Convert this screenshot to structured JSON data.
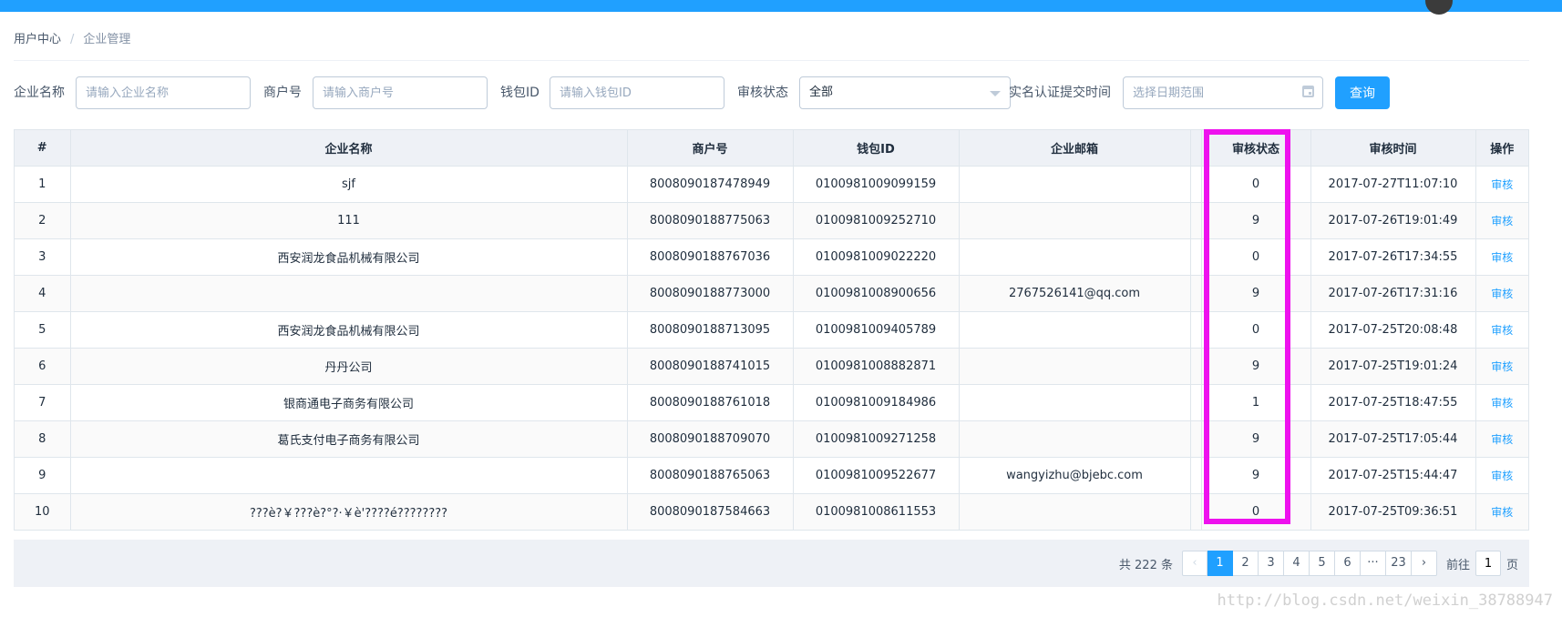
{
  "breadcrumb": {
    "root": "用户中心",
    "separator": "/",
    "current": "企业管理"
  },
  "filters": {
    "company_name_label": "企业名称",
    "company_name_placeholder": "请输入企业名称",
    "merchant_label": "商户号",
    "merchant_placeholder": "请输入商户号",
    "wallet_label": "钱包ID",
    "wallet_placeholder": "请输入钱包ID",
    "status_label": "审核状态",
    "status_value": "全部",
    "date_label": "实名认证提交时间",
    "date_placeholder": "选择日期范围",
    "query_button": "查询"
  },
  "table": {
    "headers": [
      "#",
      "企业名称",
      "商户号",
      "钱包ID",
      "企业邮箱",
      "",
      "审核状态",
      "审核时间",
      "操作"
    ],
    "rows": [
      {
        "idx": "1",
        "name": "sjf",
        "merchant": "8008090187478949",
        "wallet": "0100981009099159",
        "email": "",
        "status": "0",
        "time": "2017-07-27T11:07:10",
        "action": "审核"
      },
      {
        "idx": "2",
        "name": "111",
        "merchant": "8008090188775063",
        "wallet": "0100981009252710",
        "email": "",
        "status": "9",
        "time": "2017-07-26T19:01:49",
        "action": "审核"
      },
      {
        "idx": "3",
        "name": "西安润龙食品机械有限公司",
        "merchant": "8008090188767036",
        "wallet": "0100981009022220",
        "email": "",
        "status": "0",
        "time": "2017-07-26T17:34:55",
        "action": "审核"
      },
      {
        "idx": "4",
        "name": "",
        "merchant": "8008090188773000",
        "wallet": "0100981008900656",
        "email": "2767526141@qq.com",
        "status": "9",
        "time": "2017-07-26T17:31:16",
        "action": "审核"
      },
      {
        "idx": "5",
        "name": "西安润龙食品机械有限公司",
        "merchant": "8008090188713095",
        "wallet": "0100981009405789",
        "email": "",
        "status": "0",
        "time": "2017-07-25T20:08:48",
        "action": "审核"
      },
      {
        "idx": "6",
        "name": "丹丹公司",
        "merchant": "8008090188741015",
        "wallet": "0100981008882871",
        "email": "",
        "status": "9",
        "time": "2017-07-25T19:01:24",
        "action": "审核"
      },
      {
        "idx": "7",
        "name": "银商通电子商务有限公司",
        "merchant": "8008090188761018",
        "wallet": "0100981009184986",
        "email": "",
        "status": "1",
        "time": "2017-07-25T18:47:55",
        "action": "审核"
      },
      {
        "idx": "8",
        "name": "葛氏支付电子商务有限公司",
        "merchant": "8008090188709070",
        "wallet": "0100981009271258",
        "email": "",
        "status": "9",
        "time": "2017-07-25T17:05:44",
        "action": "审核"
      },
      {
        "idx": "9",
        "name": "",
        "merchant": "8008090188765063",
        "wallet": "0100981009522677",
        "email": "wangyizhu@bjebc.com",
        "status": "9",
        "time": "2017-07-25T15:44:47",
        "action": "审核"
      },
      {
        "idx": "10",
        "name": "???è?￥???è?°?·￥è'????é????????",
        "merchant": "8008090187584663",
        "wallet": "0100981008611553",
        "email": "",
        "status": "0",
        "time": "2017-07-25T09:36:51",
        "action": "审核"
      }
    ]
  },
  "pagination": {
    "total_text": "共 222 条",
    "prev": "‹",
    "pages": [
      "1",
      "2",
      "3",
      "4",
      "5",
      "6",
      "···",
      "23"
    ],
    "next": "›",
    "active_page": "1",
    "goto_label": "前往",
    "goto_value": "1",
    "page_unit": "页"
  },
  "watermark": "http://blog.csdn.net/weixin_38788947",
  "colors": {
    "accent": "#20a0ff",
    "highlight": "#ee11ee"
  }
}
